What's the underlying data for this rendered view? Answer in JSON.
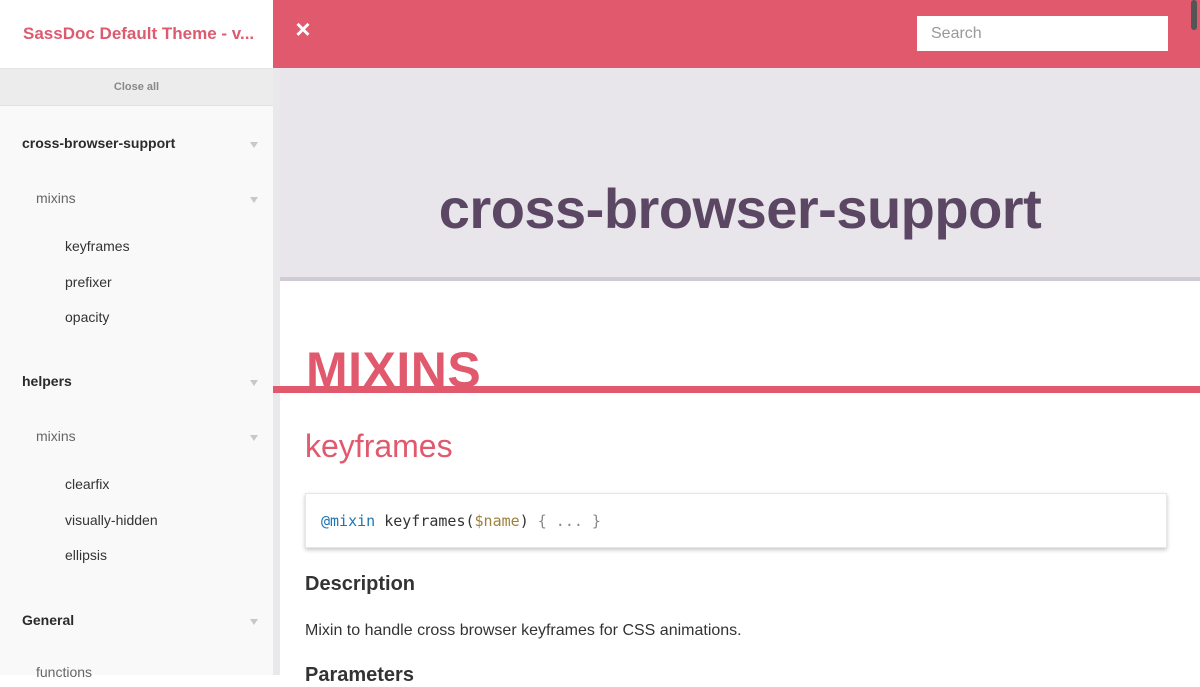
{
  "sidebar": {
    "title": "SassDoc Default Theme - v...",
    "close_all": "Close all",
    "groups": [
      {
        "label": "cross-browser-support",
        "sub": "mixins",
        "items": [
          "keyframes",
          "prefixer",
          "opacity"
        ]
      },
      {
        "label": "helpers",
        "sub": "mixins",
        "items": [
          "clearfix",
          "visually-hidden",
          "ellipsis"
        ]
      },
      {
        "label": "General",
        "sub": "functions",
        "items": []
      }
    ]
  },
  "topbar": {
    "close_icon": "×",
    "search_placeholder": "Search"
  },
  "main": {
    "hero_title": "cross-browser-support",
    "section_title": "MIXINS",
    "item_title": "keyframes",
    "code": {
      "keyword": "@mixin",
      "name": " keyframes(",
      "param": "$name",
      "close": ") ",
      "body": "{ ... }"
    },
    "description_heading": "Description",
    "description_text": "Mixin to handle cross browser keyframes for CSS animations.",
    "parameters_heading": "Parameters"
  },
  "colors": {
    "accent": "#e0596d",
    "hero_text": "#5b4664",
    "hero_bg": "#e8e6ea"
  }
}
